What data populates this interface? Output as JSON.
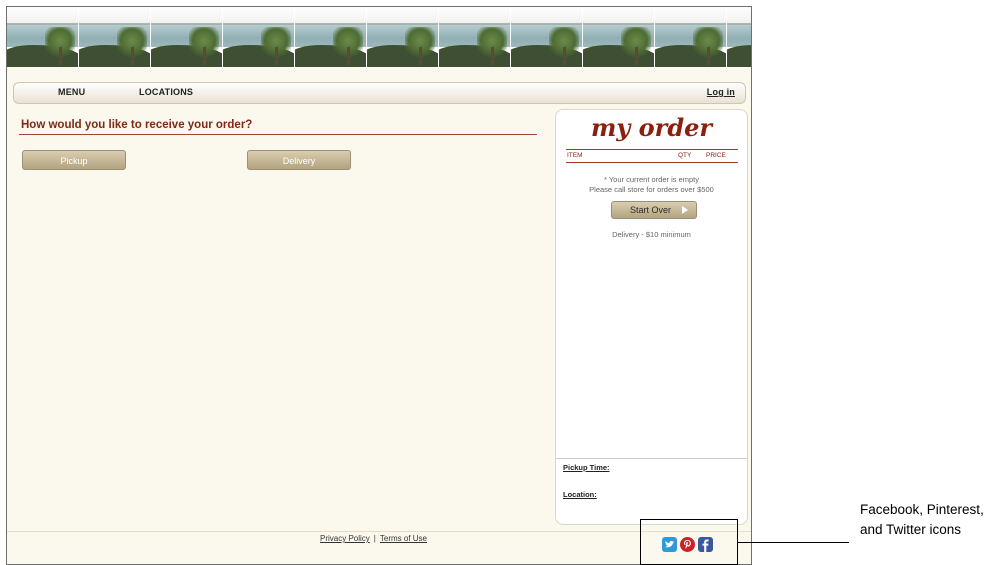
{
  "nav": {
    "menu_label": "MENU",
    "locations_label": "LOCATIONS",
    "login_label": "Log in"
  },
  "main": {
    "question": "How would you like to receive your order?",
    "options": [
      "Pickup",
      "Delivery"
    ]
  },
  "order_panel": {
    "title": "my order",
    "columns": [
      "ITEM",
      "QTY",
      "PRICE"
    ],
    "empty_line1": "* Your current order is empty",
    "empty_line2": "Please call store for orders over $500",
    "start_over_label": "Start Over",
    "delivery_note": "Delivery - $10 minimum",
    "pickup_time_label": "Pickup Time:",
    "location_label": "Location:"
  },
  "footer": {
    "privacy_label": "Privacy Policy",
    "separator": "|",
    "terms_label": "Terms of Use",
    "social_icons": [
      "twitter-icon",
      "pinterest-icon",
      "facebook-icon"
    ]
  },
  "annotation": {
    "callout_text": "Facebook, Pinterest, and Twitter icons"
  },
  "colors": {
    "accent": "#8c2010",
    "page_background": "#fbf8ee",
    "button": "#c2b48f"
  }
}
